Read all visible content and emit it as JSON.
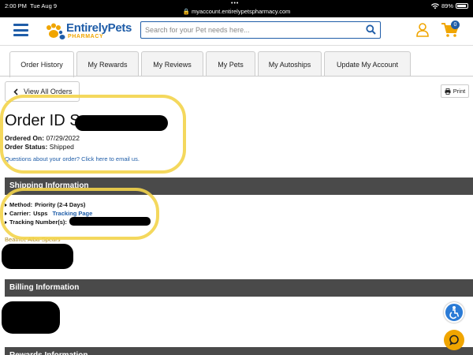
{
  "status_bar": {
    "time": "2:00 PM",
    "date": "Tue Aug 9",
    "url": "myaccount.entirelypetspharmacy.com",
    "battery": "89%"
  },
  "header": {
    "logo_name": "EntirelyPets",
    "logo_sub": "PHARMACY",
    "search_placeholder": "Search for your Pet needs here...",
    "cart_count": "0"
  },
  "tabs": [
    {
      "label": "Order History",
      "active": true
    },
    {
      "label": "My Rewards"
    },
    {
      "label": "My Reviews"
    },
    {
      "label": "My Pets"
    },
    {
      "label": "My Autoships"
    },
    {
      "label": "Update My Account"
    }
  ],
  "buttons": {
    "view_all": "View All Orders",
    "print": "Print"
  },
  "order": {
    "id_prefix": "Order ID S",
    "ordered_on_label": "Ordered On:",
    "ordered_on": "07/29/2022",
    "status_label": "Order Status:",
    "status": "Shipped",
    "question_link": "Questions about your order? Click here to email us."
  },
  "shipping": {
    "title": "Shipping Information",
    "method_label": "Method:",
    "method": "Priority (2-4 Days)",
    "carrier_label": "Carrier:",
    "carrier": "Usps",
    "tracking_link": "Tracking Page",
    "tracking_label": "Tracking Number(s):",
    "recipient": "Beatrice Alba-Spears"
  },
  "billing": {
    "title": "Billing Information"
  },
  "rewards": {
    "title": "Rewards Information"
  },
  "colors": {
    "brand_blue": "#1f5da8",
    "brand_orange": "#f0a500",
    "section_bg": "#4a4a4a",
    "annotation": "#f3d44b"
  }
}
